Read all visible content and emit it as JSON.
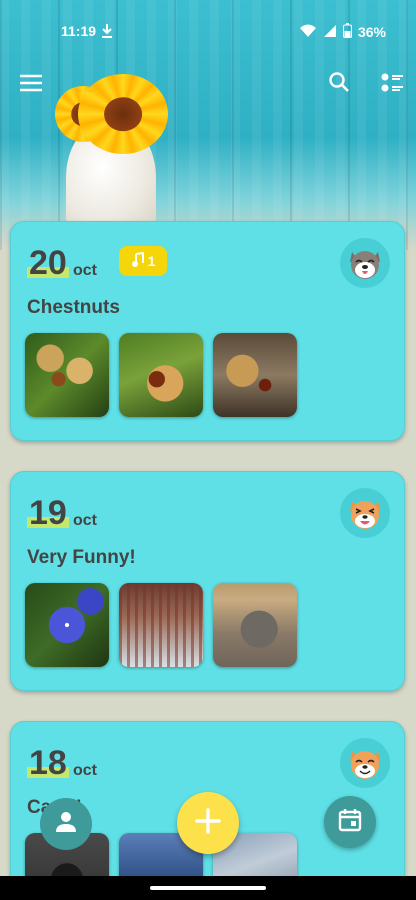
{
  "status_bar": {
    "time": "11:19",
    "battery": "36%",
    "icons": [
      "download-icon",
      "wifi-icon",
      "signal-icon",
      "battery-icon"
    ]
  },
  "app_bar": {
    "icons": [
      "menu-icon",
      "search-icon",
      "view-list-icon"
    ]
  },
  "entries": [
    {
      "day": "20",
      "month": "oct",
      "title": "Chestnuts",
      "music_count": "1",
      "avatar": "dog-happy-icon",
      "photos": [
        "chestnut-photo",
        "chestnut-photo",
        "chestnut-photo"
      ]
    },
    {
      "day": "19",
      "month": "oct",
      "title": "Very Funny!",
      "avatar": "dog-laughing-icon",
      "photos": [
        "flower-photo",
        "tree-photo",
        "bird-photo"
      ]
    },
    {
      "day": "18",
      "month": "oct",
      "title": "Capri!",
      "avatar": "dog-grin-icon",
      "photos": [
        "rock-photo",
        "sea-photo",
        "sky-photo"
      ]
    }
  ],
  "colors": {
    "card": "#5ee0e6",
    "accent_yellow": "#fde14a",
    "fab_dark": "#3f9a9a",
    "day_highlight": "#c5e86c"
  }
}
